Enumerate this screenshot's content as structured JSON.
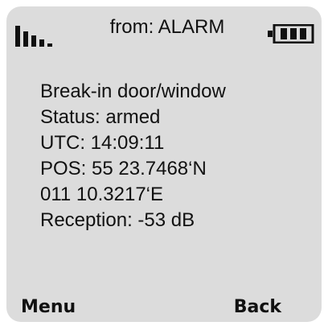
{
  "header": {
    "title": "from: ALARM",
    "signal_icon": "signal-strength-icon",
    "battery_icon": "battery-icon"
  },
  "message": {
    "lines": [
      "Break-in door/window",
      "Status: armed",
      "UTC: 14:09:11",
      "POS: 55 23.7468‘N",
      "011 10.3217‘E",
      "Reception: -53 dB"
    ]
  },
  "softkeys": {
    "left_label": "Menu",
    "right_label": "Back"
  },
  "colors": {
    "screen_background": "#dcdcdc",
    "text": "#111111"
  }
}
